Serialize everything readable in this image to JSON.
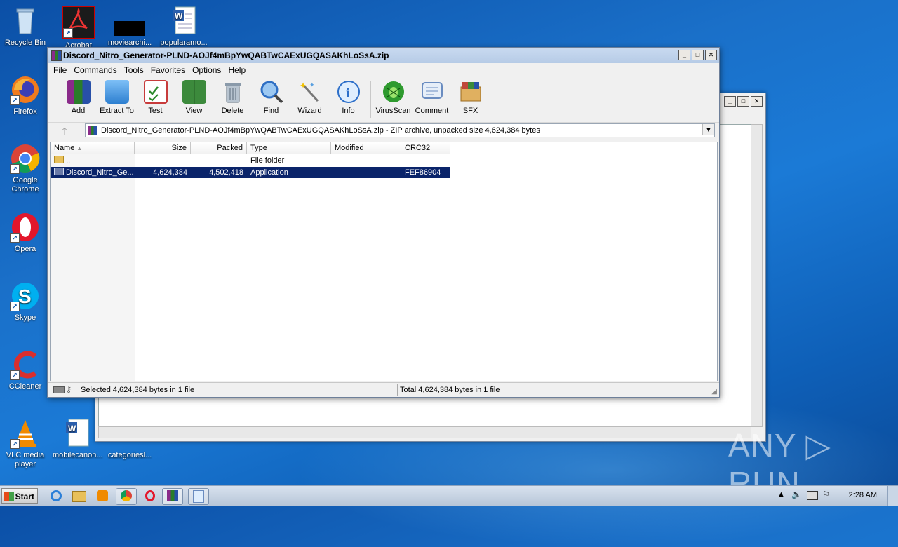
{
  "desktop_icons": [
    {
      "label": "Recycle Bin",
      "icon": "recycle-bin-icon"
    },
    {
      "label": "Acrobat",
      "icon": "acrobat-icon"
    },
    {
      "label": "moviearchi...",
      "icon": "black-file-icon"
    },
    {
      "label": "popularamo...",
      "icon": "word-doc-icon"
    },
    {
      "label": "Firefox",
      "icon": "firefox-icon"
    },
    {
      "label": "Google Chrome",
      "icon": "chrome-icon"
    },
    {
      "label": "Opera",
      "icon": "opera-icon"
    },
    {
      "label": "Skype",
      "icon": "skype-icon"
    },
    {
      "label": "CCleaner",
      "icon": "ccleaner-icon"
    },
    {
      "label": "VLC media player",
      "icon": "vlc-icon"
    },
    {
      "label": "mobilecanon...",
      "icon": "word-doc-icon"
    },
    {
      "label": "categoriesl...",
      "icon": "doc-icon"
    }
  ],
  "window": {
    "title": "Discord_Nitro_Generator-PLND-AOJf4mBpYwQABTwCAExUGQASAKhLoSsA.zip",
    "caption_buttons": {
      "minimize": "_",
      "maximize": "□",
      "close": "✕"
    }
  },
  "menu": [
    "File",
    "Commands",
    "Tools",
    "Favorites",
    "Options",
    "Help"
  ],
  "toolbar": [
    {
      "label": "Add",
      "icon": "add-archive-icon",
      "color": "#b5452b"
    },
    {
      "label": "Extract To",
      "icon": "extract-folder-icon",
      "color": "#3a8ad8"
    },
    {
      "label": "Test",
      "icon": "test-clipboard-icon",
      "color": "#c73b3b"
    },
    {
      "label": "View",
      "icon": "view-book-icon",
      "color": "#3c8a3c"
    },
    {
      "label": "Delete",
      "icon": "delete-trash-icon",
      "color": "#7a8a9a"
    },
    {
      "label": "Find",
      "icon": "find-magnifier-icon",
      "color": "#2f6fc4"
    },
    {
      "label": "Wizard",
      "icon": "wizard-wand-icon",
      "color": "#8aa0b8"
    },
    {
      "label": "Info",
      "icon": "info-icon",
      "color": "#2d6fc9"
    },
    {
      "label": "VirusScan",
      "icon": "virusscan-bug-icon",
      "color": "#2e9a2e"
    },
    {
      "label": "Comment",
      "icon": "comment-icon",
      "color": "#6a8cc0"
    },
    {
      "label": "SFX",
      "icon": "sfx-box-icon",
      "color": "#c0483a"
    }
  ],
  "address": "Discord_Nitro_Generator-PLND-AOJf4mBpYwQABTwCAExUGQASAKhLoSsA.zip - ZIP archive, unpacked size 4,624,384 bytes",
  "columns": [
    "Name",
    "Size",
    "Packed",
    "Type",
    "Modified",
    "CRC32"
  ],
  "rows": [
    {
      "name": "..",
      "size": "",
      "packed": "",
      "type": "File folder",
      "modified": "",
      "crc": "",
      "selected": false
    },
    {
      "name": "Discord_Nitro_Ge...",
      "size": "4,624,384",
      "packed": "4,502,418",
      "type": "Application",
      "modified": "",
      "crc": "FEF86904",
      "selected": true
    }
  ],
  "status": {
    "left": "Selected 4,624,384 bytes in 1 file",
    "right": "Total 4,624,384 bytes in 1 file"
  },
  "taskbar": {
    "start_label": "Start",
    "clock": "2:28 AM",
    "items": [
      "ie-icon",
      "explorer-icon",
      "media-player-icon",
      "chrome-icon",
      "opera-icon",
      "winrar-icon",
      "notepad-icon"
    ]
  },
  "watermark": "ANY ▷ RUN"
}
